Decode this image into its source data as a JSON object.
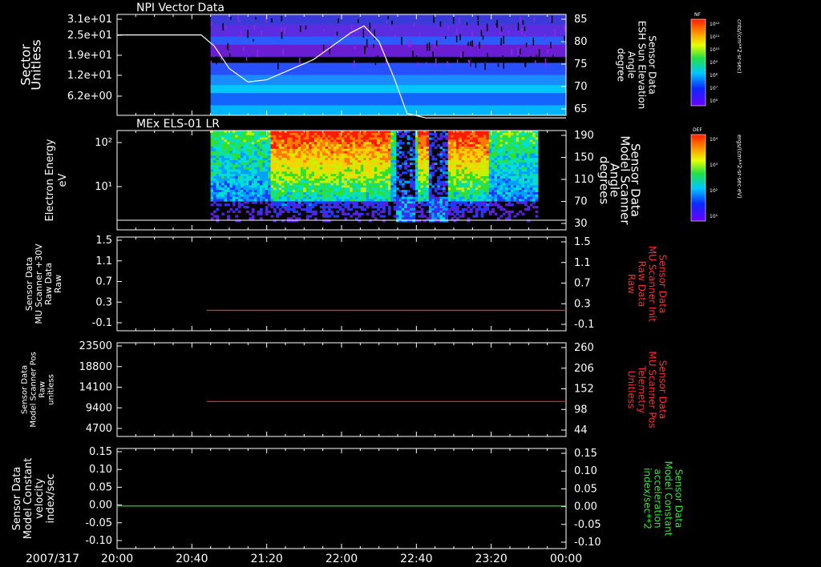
{
  "date_label": "2007/317",
  "x_ticks": [
    "20:00",
    "20:40",
    "21:20",
    "22:00",
    "22:40",
    "23:20",
    "00:00"
  ],
  "colorbars": [
    {
      "name": "NF",
      "unit": "cnts/(cm**2-sr-sec)",
      "ticks": [
        "10¹²",
        "10¹¹",
        "10¹⁰",
        "10⁹",
        "10⁸",
        "10⁷",
        "10⁶"
      ]
    },
    {
      "name": "DEF",
      "unit": "ergs/(cm**2-sr-sec-eV)",
      "ticks": [
        "10⁴",
        "10³",
        "10²",
        "10¹"
      ]
    }
  ],
  "chart_data": [
    {
      "type": "heatmap",
      "title": "NPI Vector Data",
      "ylabel": [
        "Sector",
        "Unitless"
      ],
      "y_ticks": [
        "3.1e+01",
        "2.5e+01",
        "1.9e+01",
        "1.2e+01",
        "6.2e+00"
      ],
      "data_start": "20:50",
      "right_axis": {
        "label": [
          "Sensor Data",
          "ESH Sun Elevation",
          "Angle",
          "degree"
        ],
        "color": "#ffffff",
        "ticks": [
          "85",
          "80",
          "75",
          "70",
          "65"
        ]
      },
      "overlay_line": {
        "color": "#ffffff",
        "x": [
          "20:00",
          "20:45",
          "20:52",
          "21:00",
          "21:10",
          "21:20",
          "21:45",
          "22:05",
          "22:12",
          "22:20",
          "22:28",
          "22:35",
          "22:45",
          "00:00"
        ],
        "y": [
          81.5,
          81.5,
          79,
          74,
          71,
          71.5,
          76,
          82,
          83.5,
          80,
          72,
          64,
          63,
          63
        ]
      }
    },
    {
      "type": "heatmap",
      "title": "MEx ELS-01 LR",
      "ylabel": [
        "Electron Energy",
        "eV"
      ],
      "y_ticks": [
        "10²",
        "10¹"
      ],
      "data_start": "20:50",
      "data_end": "23:45",
      "right_axis": {
        "label": [
          "Sensor Data",
          "Model Scanner",
          "Angle",
          "degrees"
        ],
        "color": "#ffffff",
        "ticks": [
          "190",
          "150",
          "110",
          "70",
          "30"
        ]
      }
    },
    {
      "type": "line",
      "ylabel": [
        "Sensor Data",
        "MU Scanner +30V",
        "Raw Data",
        "Raw"
      ],
      "y_ticks": [
        "1.5",
        "1.1",
        "0.7",
        "0.3",
        "-0.1"
      ],
      "ylim": [
        -0.3,
        1.5
      ],
      "right_axis": {
        "label": [
          "Sensor Data",
          "MU Scanner Init",
          "Raw Data",
          "Raw"
        ],
        "color": "#ff2a2a",
        "ticks": [
          "1.5",
          "1.1",
          "0.7",
          "0.3",
          "-0.1"
        ]
      },
      "series": [
        {
          "color": "#ff2a2a",
          "x": [
            "20:48",
            "00:00"
          ],
          "y": [
            0.0,
            0.0
          ]
        }
      ]
    },
    {
      "type": "line",
      "ylabel": [
        "Sensor Data",
        "Model Scanner Pos",
        "Raw",
        "unitless"
      ],
      "y_ticks": [
        "23500",
        "18800",
        "14100",
        "9400",
        "4700"
      ],
      "ylim": [
        0,
        23500
      ],
      "right_axis": {
        "label": [
          "Sensor Data",
          "MU Scanner Pos",
          "Telemetry",
          "Unitless"
        ],
        "color": "#ff2a2a",
        "ticks": [
          "260",
          "206",
          "152",
          "98",
          "44"
        ]
      },
      "series": [
        {
          "color": "#ff2a2a",
          "x": [
            "20:48",
            "00:00"
          ],
          "y": [
            8000,
            8000
          ]
        }
      ]
    },
    {
      "type": "line",
      "ylabel": [
        "Sensor Data",
        "Model Constant",
        "velocity",
        "index/sec"
      ],
      "y_ticks": [
        "0.15",
        "0.10",
        "0.05",
        "0.00",
        "-0.05",
        "-0.10"
      ],
      "ylim": [
        -0.1,
        0.15
      ],
      "right_axis": {
        "label": [
          "Sensor Data",
          "Model Constant",
          "acceleration",
          "index/sec**2"
        ],
        "color": "#33e633",
        "ticks": [
          "0.15",
          "0.10",
          "0.05",
          "0.00",
          "-0.05",
          "-0.10"
        ]
      },
      "series": [
        {
          "color": "#33e633",
          "x": [
            "20:00",
            "00:00"
          ],
          "y": [
            0.0,
            0.0
          ]
        }
      ]
    }
  ]
}
